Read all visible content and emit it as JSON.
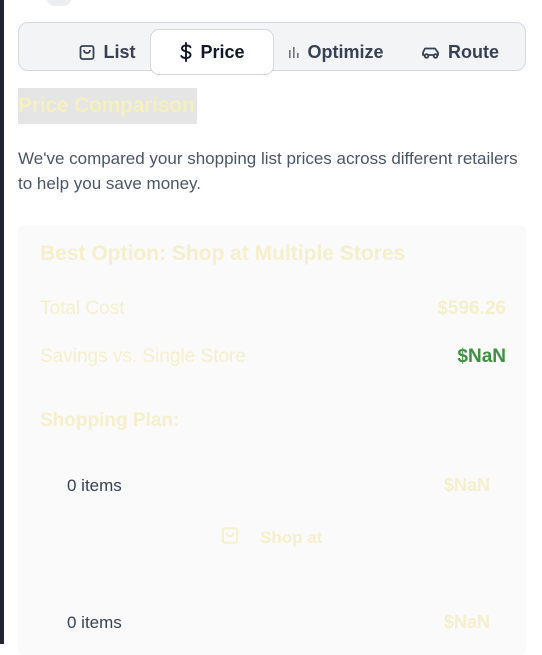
{
  "tabs": [
    {
      "label": "List",
      "icon": "shopping-bag-icon",
      "active": false
    },
    {
      "label": "Price",
      "icon": "dollar-icon",
      "active": true
    },
    {
      "label": "Optimize",
      "icon": "bar-chart-icon",
      "active": false
    },
    {
      "label": "Route",
      "icon": "car-icon",
      "active": false
    }
  ],
  "section": {
    "title": "Price Comparison",
    "description": "We've compared your shopping list prices across different retailers to help you save money."
  },
  "summary": {
    "best_option": "Best Option: Shop at Multiple Stores",
    "total_cost_label": "Total Cost",
    "total_cost_value": "$596.26",
    "savings_label": "Savings vs. Single Store",
    "savings_value": "$NaN"
  },
  "plan": {
    "title": "Shopping Plan:",
    "stores": [
      {
        "items": "0 items",
        "value": "$NaN",
        "shop_at": "Shop at"
      },
      {
        "items": "0 items",
        "value": "$NaN"
      }
    ]
  },
  "colors": {
    "accent_text": "#f5efcb",
    "savings_green": "#3f9142",
    "tab_border": "#d4d7dd"
  }
}
